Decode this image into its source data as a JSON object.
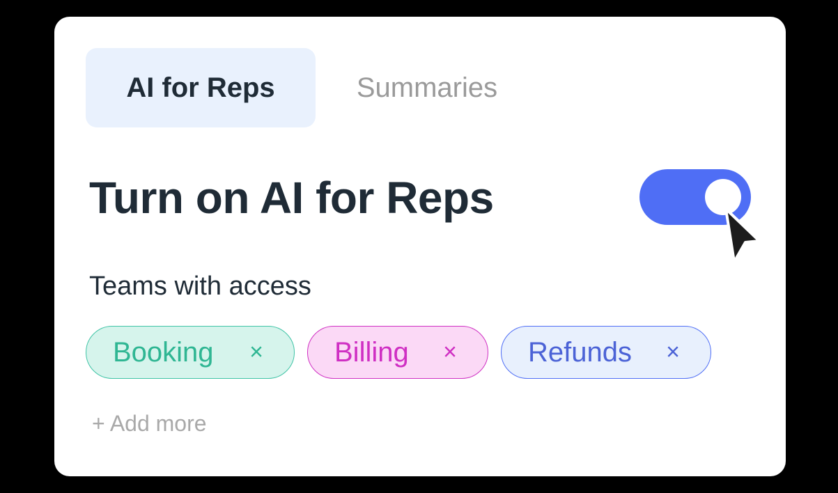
{
  "tabs": [
    {
      "label": "AI for Reps",
      "active": true
    },
    {
      "label": "Summaries",
      "active": false
    }
  ],
  "main": {
    "heading": "Turn on AI for Reps",
    "toggle_on": true,
    "teams_label": "Teams with access",
    "add_more_label": "+ Add more"
  },
  "chips": [
    {
      "label": "Booking",
      "remove": "×",
      "color": "#2fb693"
    },
    {
      "label": "Billing",
      "remove": "×",
      "color": "#cf2fc3"
    },
    {
      "label": "Refunds",
      "remove": "×",
      "color": "#4b62d6"
    }
  ],
  "colors": {
    "accent": "#4f6ef5",
    "text_primary": "#1f2b36",
    "text_muted": "#9a9a9a",
    "active_tab_bg": "#e9f1fd"
  },
  "icons": {
    "cursor": "mouse-pointer-icon",
    "remove": "close-icon"
  }
}
